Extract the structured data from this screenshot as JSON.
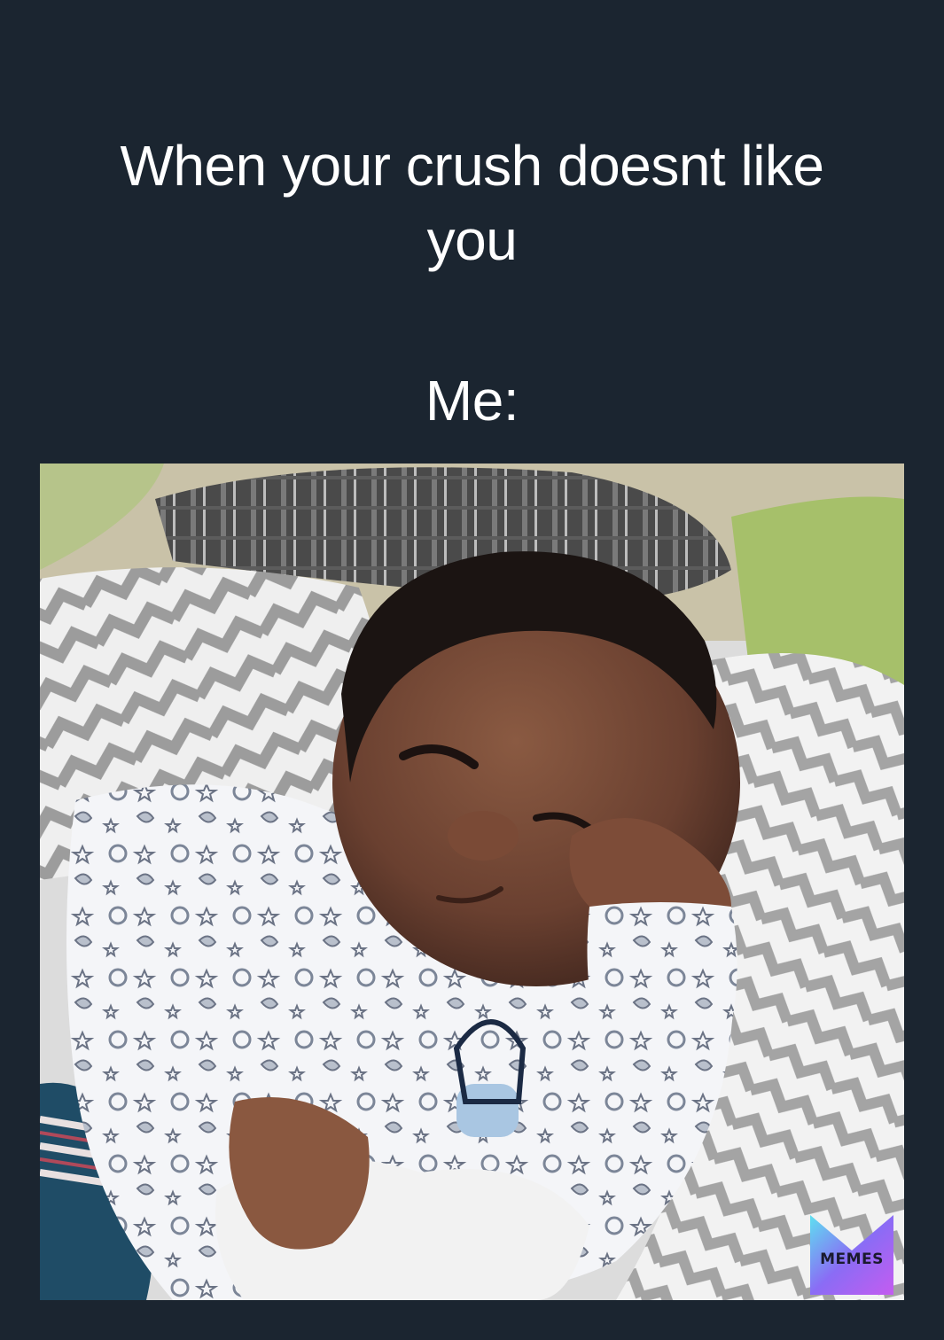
{
  "caption": {
    "line1": "When your crush doesnt like",
    "line2": "you",
    "line3": "Me:"
  },
  "watermark": {
    "label": "MEMES",
    "colors": [
      "#5ee0f0",
      "#8a6cf5",
      "#c45cf0"
    ]
  },
  "colors": {
    "background": "#1b2530",
    "text": "#ffffff"
  }
}
